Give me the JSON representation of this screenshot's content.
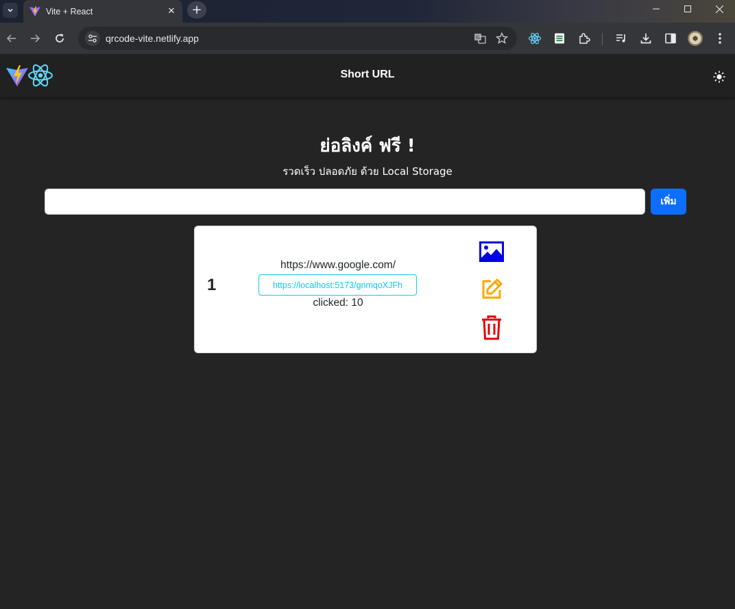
{
  "browser": {
    "tab_title": "Vite + React",
    "url": "qrcode-vite.netlify.app"
  },
  "header": {
    "title": "Short URL"
  },
  "hero": {
    "title": "ย่อลิงค์ ฟรี !",
    "subtitle": "รวดเร็ว ปลอดภัย ด้วย Local Storage"
  },
  "form": {
    "input_value": "",
    "add_label": "เพิ่ม",
    "accent_color": "#0d6efd"
  },
  "links": [
    {
      "index": "1",
      "original_url": "https://www.google.com/",
      "short_url": "https://localhost:5173/gnmqoXJFh",
      "clicks_text": "clicked: 10"
    }
  ],
  "actions": {
    "qr_icon": "image-icon",
    "edit_icon": "edit-icon",
    "delete_icon": "trash-icon",
    "qr_color": "#0000e6",
    "edit_color": "#ffa500",
    "delete_color": "#e60000"
  }
}
